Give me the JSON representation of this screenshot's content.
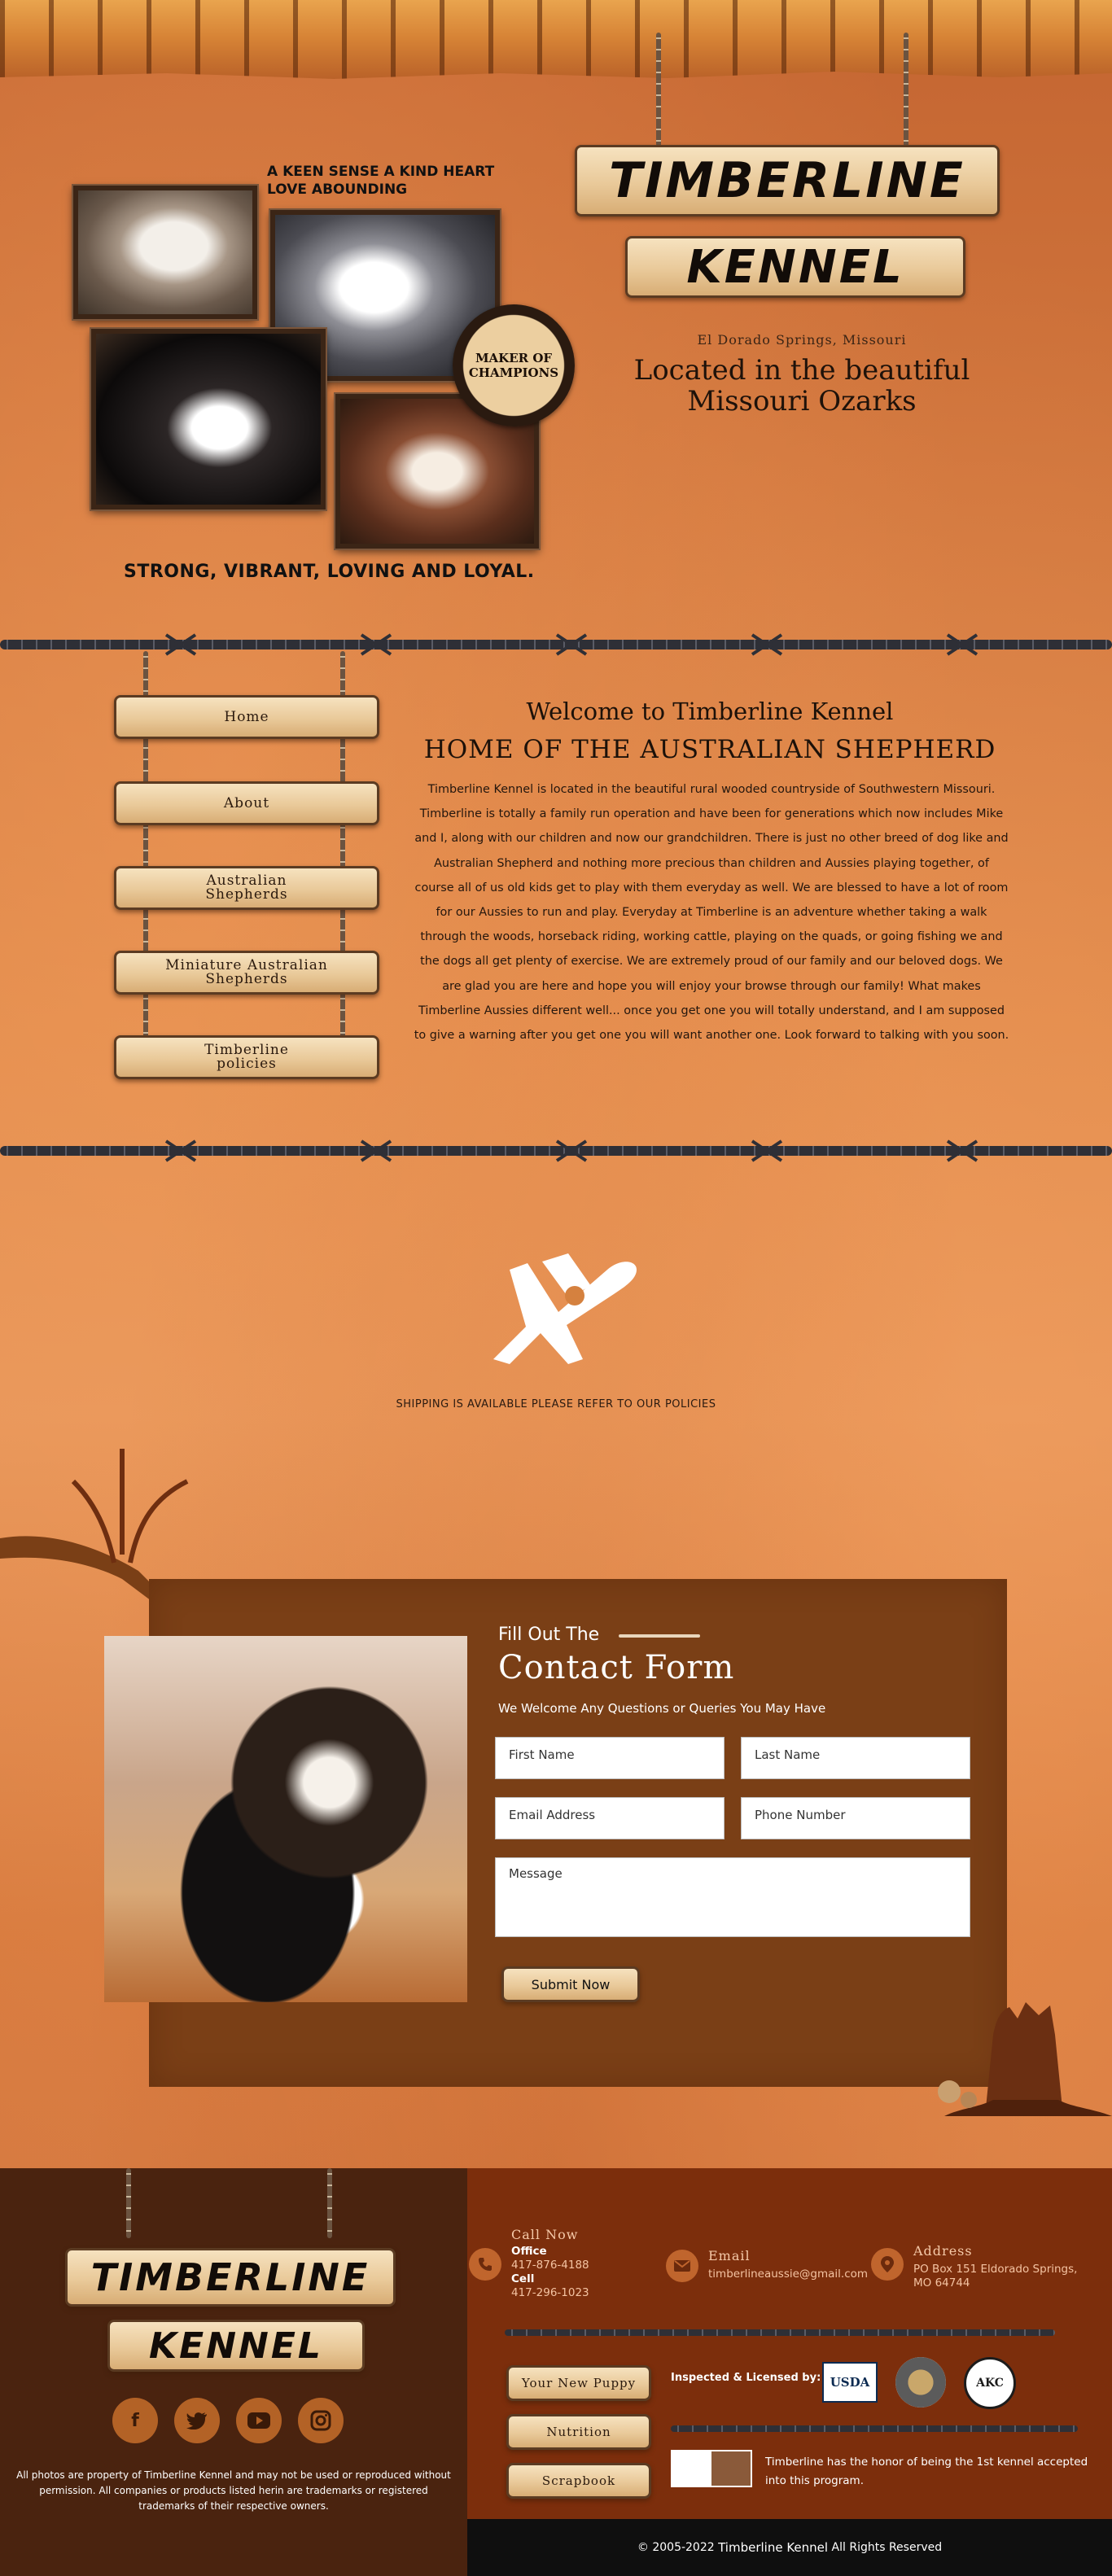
{
  "header": {
    "tagline": [
      "A KEEN SENSE A KIND HEART",
      "LOVE ABOUNDING"
    ],
    "logo_line1": "TIMBERLINE",
    "logo_line2": "KENNEL",
    "badge": [
      "MAKER OF",
      "CHAMPIONS"
    ],
    "location_small": "El Dorado Springs, Missouri",
    "location_big_line1": "Located in the beautiful",
    "location_big_line2": "Missouri Ozarks",
    "slogan": "STRONG, VIBRANT, LOVING AND LOYAL."
  },
  "nav": {
    "items": [
      {
        "label_line1": "Home",
        "label_line2": ""
      },
      {
        "label_line1": "About",
        "label_line2": ""
      },
      {
        "label_line1": "Australian",
        "label_line2": "Shepherds"
      },
      {
        "label_line1": "Miniature Australian",
        "label_line2": "Shepherds"
      },
      {
        "label_line1": "Timberline",
        "label_line2": "policies"
      }
    ]
  },
  "welcome": {
    "title": "Welcome to Timberline Kennel",
    "subtitle": "HOME OF THE AUSTRALIAN SHEPHERD",
    "body": "Timberline Kennel is located in the beautiful rural wooded countryside of Southwestern Missouri. Timberline is totally a family run operation and have been for generations which now includes Mike and I, along with our children and now our grandchildren. There is just no other breed of dog like and Australian Shepherd and nothing more precious than children and Aussies playing together, of course all of us old kids get to play with them everyday as well. We are blessed to have a lot of room for our Aussies to run and play. Everyday at Timberline is an adventure whether taking a walk through the woods, horseback riding, working cattle, playing on the quads, or going fishing we and the dogs all get plenty of exercise. We are extremely proud of our family and our beloved dogs. We are glad you are here and hope you will enjoy your browse through our family! What makes Timberline Aussies different well... once you get one you will totally understand, and I am supposed to give a warning after you get one you will want another one. Look forward to talking with you soon."
  },
  "shipping": {
    "text": "SHIPPING IS AVAILABLE PLEASE REFER TO OUR POLICIES",
    "icon": "airplane-icon"
  },
  "contact_form": {
    "heading_small": "Fill Out The",
    "heading_big": "Contact Form",
    "welcome": "We Welcome Any Questions or Queries You May Have",
    "first_name": "First Name",
    "last_name": "Last Name",
    "email": "Email Address",
    "phone": "Phone Number",
    "message": "Message",
    "submit": "Submit Now"
  },
  "footer": {
    "logo_line1": "TIMBERLINE",
    "logo_line2": "KENNEL",
    "social": [
      "facebook-icon",
      "twitter-icon",
      "youtube-icon",
      "instagram-icon"
    ],
    "note": "All photos are property of Timberline Kennel and may not be used or reproduced without permission. All companies or products listed herin are trademarks or registered trademarks of their respective owners.",
    "call_title": "Call Now",
    "office_label": "Office",
    "office_phone": "417-876-4188",
    "cell_label": "Cell",
    "cell_phone": "417-296-1023",
    "email_title": "Email",
    "email": "timberlineaussie@gmail.com",
    "address_title": "Address",
    "address": "PO Box 151 Eldorado Springs, MO 64744",
    "links": [
      "Your New Puppy",
      "Nutrition",
      "Scrapbook"
    ],
    "inspected": "Inspected & Licensed by:",
    "seals": [
      "USDA",
      "AKC"
    ],
    "honor": "Timberline has the honor of being the 1st kennel accepted into this program.",
    "copyright_prefix": "© 2005-2022",
    "copyright_name": "Timberline Kennel",
    "copyright_suffix": "All Rights Reserved"
  },
  "colors": {
    "accent": "#7c2e0c",
    "footer_dark": "#4a230f",
    "form_box": "#7a3f16"
  }
}
